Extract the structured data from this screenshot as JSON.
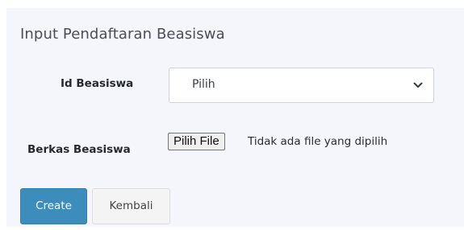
{
  "form": {
    "title": "Input Pendaftaran Beasiswa",
    "id_beasiswa": {
      "label": "Id Beasiswa",
      "selected": "Pilih"
    },
    "berkas_beasiswa": {
      "label": "Berkas Beasiswa",
      "button_label": "Pilih File",
      "status_text": "Tidak ada file yang dipilih"
    },
    "actions": {
      "create_label": "Create",
      "back_label": "Kembali"
    }
  },
  "colors": {
    "primary": "#3c8dbc",
    "panel_bg": "#f4f6fb"
  },
  "icons": {
    "select_arrow": "chevron-down-icon"
  }
}
